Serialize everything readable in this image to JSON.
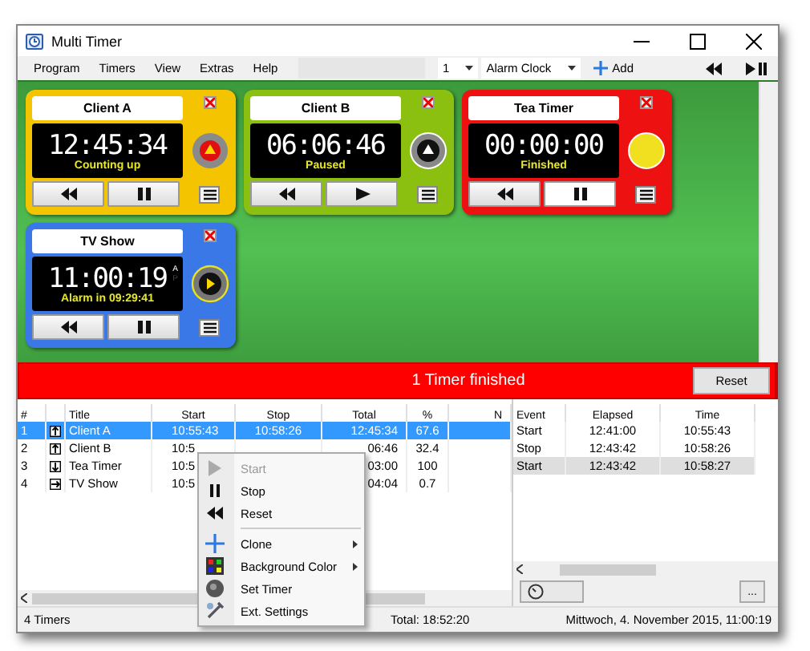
{
  "window": {
    "title": "Multi Timer"
  },
  "menu": [
    "Program",
    "Timers",
    "View",
    "Extras",
    "Help"
  ],
  "toolbar": {
    "count": "1",
    "preset": "Alarm Clock",
    "add": "Add"
  },
  "timers": [
    {
      "title": "Client A",
      "time": "12:45:34",
      "status": "Counting up",
      "color": "#f5c400",
      "kind": "alarm",
      "paused": false,
      "pressed": false
    },
    {
      "title": "Client B",
      "time": "06:06:46",
      "status": "Paused",
      "color": "#8cc010",
      "kind": "up",
      "paused": true,
      "pressed": false
    },
    {
      "title": "Tea Timer",
      "time": "00:00:00",
      "status": "Finished",
      "color": "#ee1111",
      "kind": "ball",
      "paused": false,
      "pressed": true
    },
    {
      "title": "TV Show",
      "time": "11:00:19",
      "status": "Alarm in 09:29:41",
      "color": "#3a78e8",
      "kind": "play",
      "paused": false,
      "pressed": false,
      "meridiem": [
        {
          "label": "A",
          "selected": true
        },
        {
          "label": "P",
          "selected": false
        }
      ]
    }
  ],
  "banner": {
    "text": "1 Timer finished",
    "button": "Reset"
  },
  "table": {
    "columns": [
      "#",
      "Title",
      "Start",
      "Stop",
      "Total",
      "%",
      "N"
    ],
    "rows": [
      {
        "num": "1",
        "kind": "up",
        "title": "Client A",
        "start": "10:55:43",
        "stop": "10:58:26",
        "total": "12:45:34",
        "pct": "67.6",
        "selected": true
      },
      {
        "num": "2",
        "kind": "up",
        "title": "Client B",
        "start": "10:5",
        "stop": "",
        "total": "06:46",
        "pct": "32.4",
        "selected": false
      },
      {
        "num": "3",
        "kind": "down",
        "title": "Tea Timer",
        "start": "10:5",
        "stop": "",
        "total": "03:00",
        "pct": "100",
        "selected": false
      },
      {
        "num": "4",
        "kind": "right",
        "title": "TV Show",
        "start": "10:5",
        "stop": "",
        "total": "04:04",
        "pct": "0.7",
        "selected": false
      }
    ]
  },
  "events": {
    "columns": [
      "Event",
      "Elapsed",
      "Time"
    ],
    "rows": [
      {
        "event": "Start",
        "elapsed": "12:41:00",
        "time": "10:55:43",
        "selected": false
      },
      {
        "event": "Stop",
        "elapsed": "12:43:42",
        "time": "10:58:26",
        "selected": false
      },
      {
        "event": "Start",
        "elapsed": "12:43:42",
        "time": "10:58:27",
        "selected": true
      }
    ],
    "more": "..."
  },
  "context_menu": [
    {
      "kind": "start",
      "label": "Start",
      "disabled": true,
      "submenu": false,
      "separator_after": false
    },
    {
      "kind": "stop",
      "label": "Stop",
      "disabled": false,
      "submenu": false,
      "separator_after": false
    },
    {
      "kind": "reset",
      "label": "Reset",
      "disabled": false,
      "submenu": false,
      "separator_after": true
    },
    {
      "kind": "clone",
      "label": "Clone",
      "disabled": false,
      "submenu": true,
      "separator_after": false
    },
    {
      "kind": "color",
      "label": "Background Color",
      "disabled": false,
      "submenu": true,
      "separator_after": false
    },
    {
      "kind": "timer",
      "label": "Set Timer",
      "disabled": false,
      "submenu": false,
      "separator_after": false
    },
    {
      "kind": "settings",
      "label": "Ext. Settings",
      "disabled": false,
      "submenu": false,
      "separator_after": false
    }
  ],
  "status_bar": {
    "count": "4 Timers",
    "total": "Total: 18:52:20",
    "date": "Mittwoch, 4. November 2015, 11:00:19"
  }
}
